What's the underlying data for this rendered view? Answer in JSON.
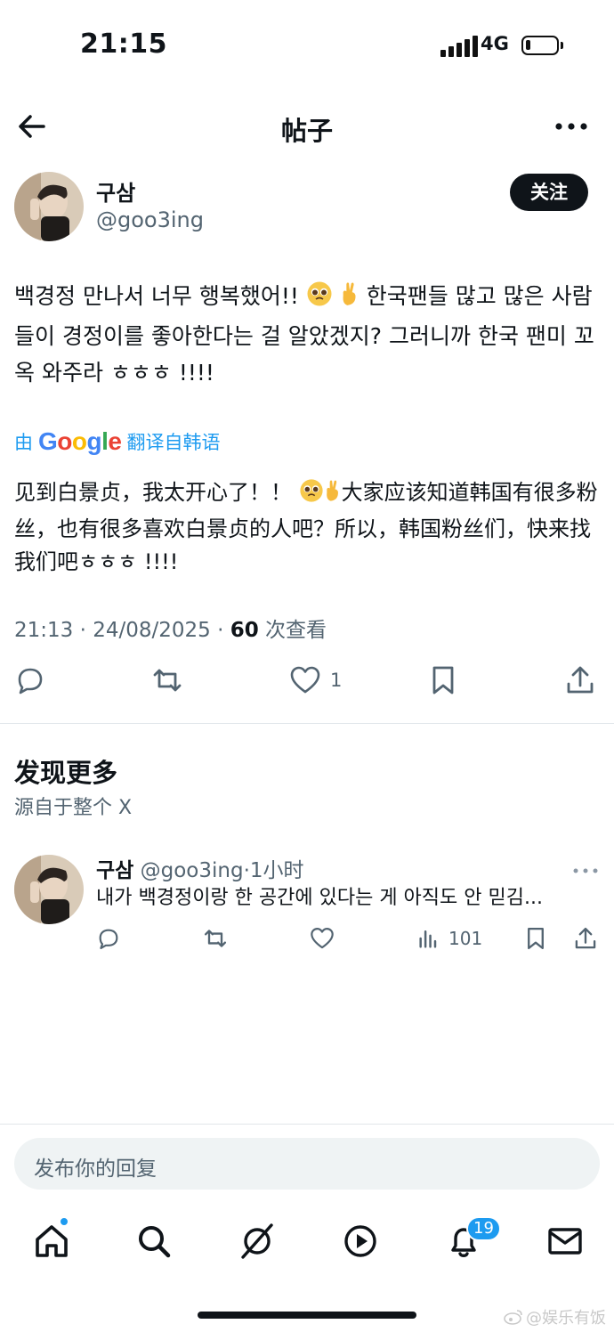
{
  "status_bar": {
    "time": "21:15",
    "network": "4G",
    "battery_level": 0.15
  },
  "header": {
    "title": "帖子",
    "back_icon": "arrow-left-icon",
    "more_icon": "more-horizontal-icon"
  },
  "post": {
    "author_name": "구삼",
    "author_handle": "@goo3ing",
    "follow_label": "关注",
    "text_part1": "백경정 만나서 너무 행복했어!! ",
    "text_part2": " 한국팬들 많고 많은 사람들이 경정이를 좋아한다는 걸 알았겠지? 그러니까 한국 팬미 꼬옥 와주라 ㅎㅎㅎ !!!!",
    "emojis": [
      "pleading-face-emoji",
      "crossed-fingers-emoji"
    ],
    "translate_by": "由",
    "translate_brand": "Google",
    "translate_from": "翻译自韩语",
    "translated_part1": "见到白景贞，我太开心了！！ ",
    "translated_part2": "大家应该知道韩国有很多粉丝，也有很多喜欢白景贞的人吧？所以，韩国粉丝们，快来找我们吧ㅎㅎㅎ !!!!",
    "timestamp": "21:13 · 24/08/2025 · ",
    "views_count": "60",
    "views_label": " 次查看",
    "like_count": "1"
  },
  "discover": {
    "title": "发现更多",
    "subtitle": "源自于整个 X",
    "tweet": {
      "author_name": "구삼",
      "handle_time": " @goo3ing·1小时",
      "text": "내가 백경정이랑 한 공간에 있다는 게 아직도 안 믿김...",
      "views": "101"
    }
  },
  "reply": {
    "placeholder": "发布你的回复"
  },
  "bottom_nav": {
    "items": [
      "home-icon",
      "search-icon",
      "grok-icon",
      "video-icon",
      "notifications-icon",
      "messages-icon"
    ],
    "notification_count": "19"
  },
  "watermark": "@娱乐有饭",
  "colors": {
    "accent": "#1d9bf0",
    "text": "#0f1419",
    "secondary": "#536471",
    "follow_bg": "#0f1419"
  }
}
